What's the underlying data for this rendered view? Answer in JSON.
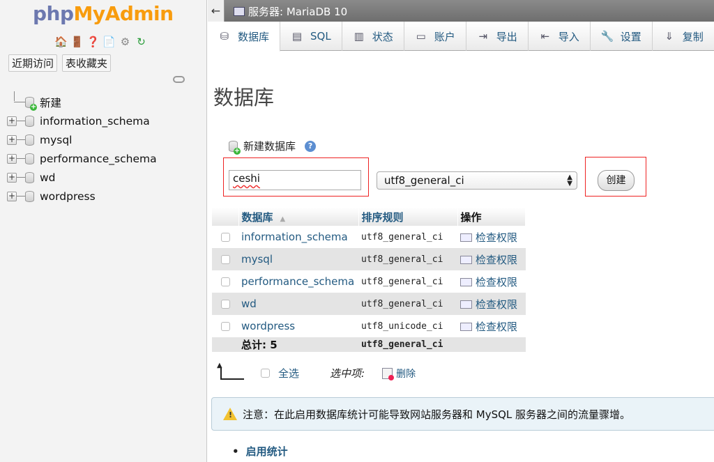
{
  "app": {
    "logo_php": "php",
    "logo_rest": "MyAdmin"
  },
  "sidebar": {
    "buttons": [
      "近期访问",
      "表收藏夹"
    ],
    "new_label": "新建",
    "databases": [
      "information_schema",
      "mysql",
      "performance_schema",
      "wd",
      "wordpress"
    ]
  },
  "topbar": {
    "back_glyph": "←",
    "server": "服务器: MariaDB 10"
  },
  "tabs": [
    {
      "label": "数据库",
      "icon": "database-icon"
    },
    {
      "label": "SQL",
      "icon": "sql-icon"
    },
    {
      "label": "状态",
      "icon": "status-icon"
    },
    {
      "label": "账户",
      "icon": "accounts-icon"
    },
    {
      "label": "导出",
      "icon": "export-icon"
    },
    {
      "label": "导入",
      "icon": "import-icon"
    },
    {
      "label": "设置",
      "icon": "settings-icon"
    },
    {
      "label": "复制",
      "icon": "replication-icon"
    }
  ],
  "main": {
    "title": "数据库",
    "create_heading": "新建数据库",
    "db_name_value": "ceshi",
    "collation_selected": "utf8_general_ci",
    "create_button": "创建",
    "table": {
      "headers": {
        "database": "数据库",
        "collation": "排序规则",
        "action": "操作"
      },
      "rows": [
        {
          "name": "information_schema",
          "collation": "utf8_general_ci",
          "action": "检查权限"
        },
        {
          "name": "mysql",
          "collation": "utf8_general_ci",
          "action": "检查权限"
        },
        {
          "name": "performance_schema",
          "collation": "utf8_general_ci",
          "action": "检查权限"
        },
        {
          "name": "wd",
          "collation": "utf8_general_ci",
          "action": "检查权限"
        },
        {
          "name": "wordpress",
          "collation": "utf8_unicode_ci",
          "action": "检查权限"
        }
      ],
      "total_label": "总计: 5",
      "total_collation": "utf8_general_ci"
    },
    "bulk": {
      "select_all": "全选",
      "with_selected": "选中项:",
      "delete": "删除"
    },
    "notice": "注意：在此启用数据库统计可能导致网站服务器和 MySQL 服务器之间的流量骤增。",
    "enable_stats": "启用统计"
  },
  "colors": {
    "link": "#235a81",
    "logo_php": "#6c78af",
    "logo_rest": "#f89c0e",
    "highlight_box": "#e22222"
  }
}
